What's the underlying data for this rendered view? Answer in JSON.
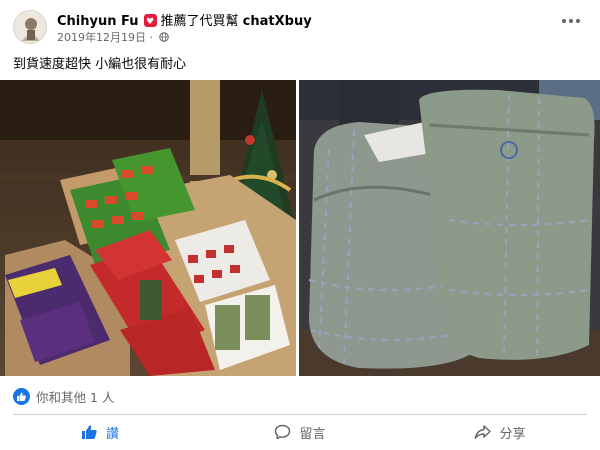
{
  "post": {
    "author": "Chihyun Fu",
    "action": "推薦了代買幫",
    "page": "chatXbuy",
    "date": "2019年12月19日",
    "separator": "·",
    "more_label": "···",
    "text": "到貨速度超快 小編也很有耐心"
  },
  "reactions": {
    "summary": "你和其他 1 人"
  },
  "actions": {
    "like": "讚",
    "comment": "留言",
    "share": "分享"
  },
  "colors": {
    "brand_blue": "#1b74e4",
    "secondary_text": "#65676b",
    "badge_red": "#e41e3f"
  },
  "icons": [
    "recommend-badge-icon",
    "globe-icon",
    "more-icon",
    "like-icon",
    "comment-icon",
    "share-icon"
  ]
}
